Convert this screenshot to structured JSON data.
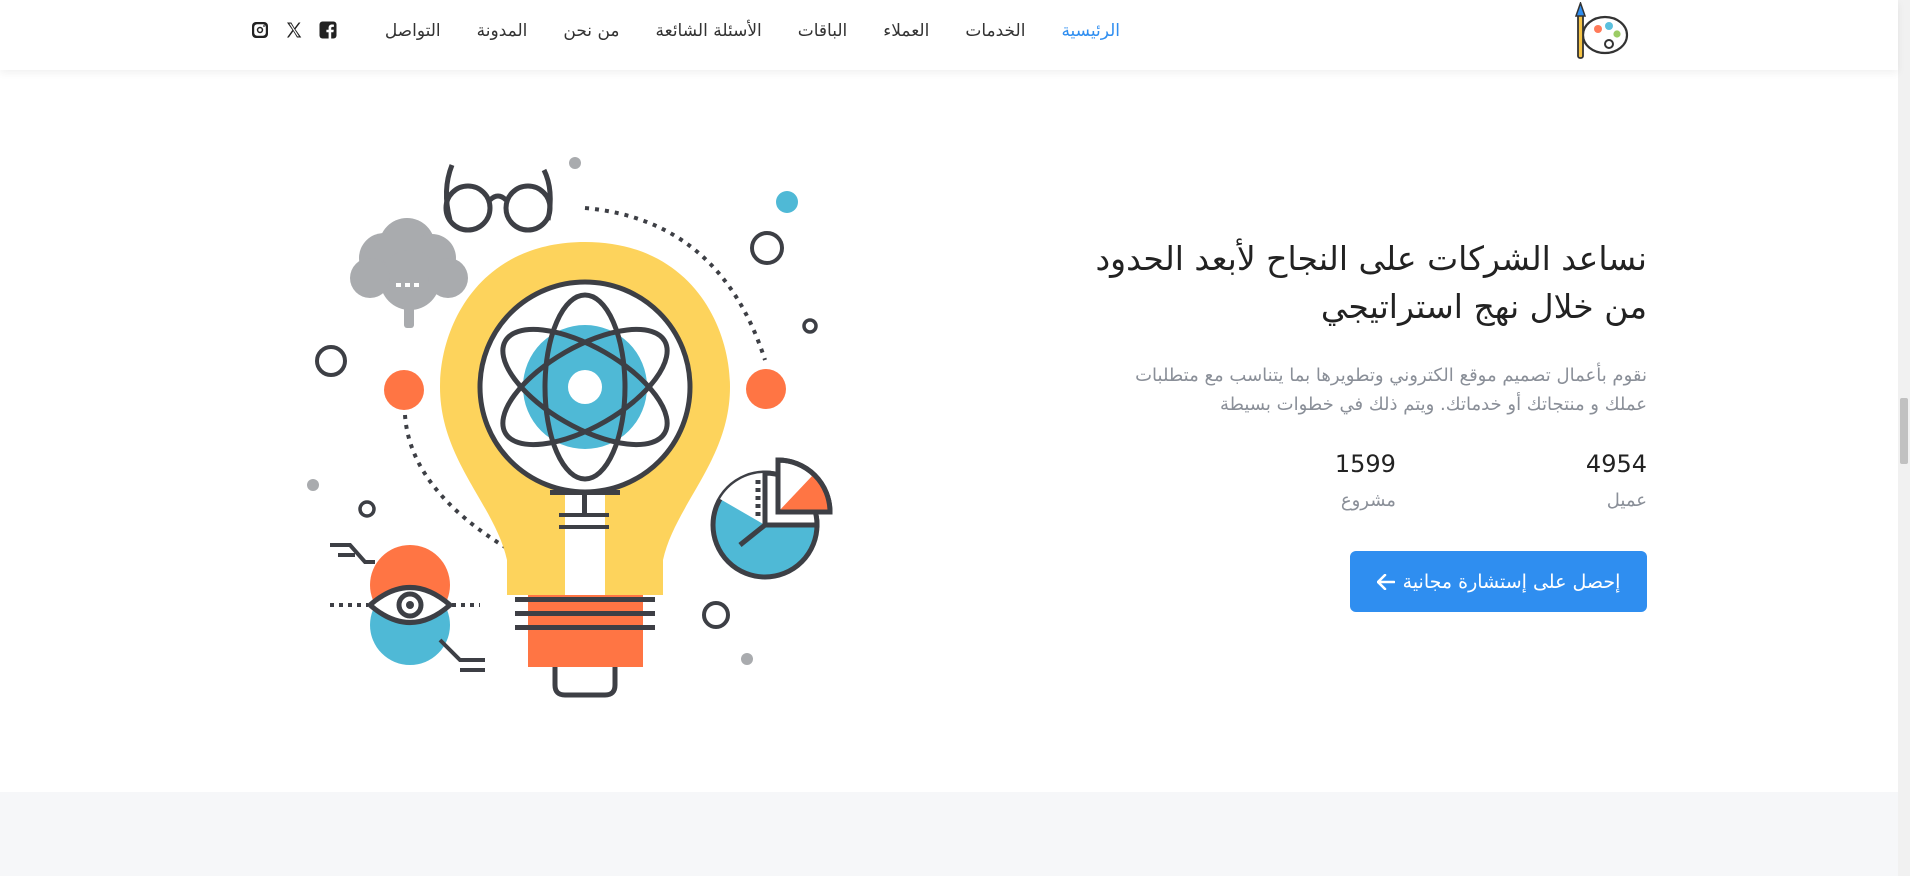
{
  "header": {
    "nav": [
      {
        "label": "الرئيسية",
        "active": true
      },
      {
        "label": "الخدمات",
        "active": false
      },
      {
        "label": "العملاء",
        "active": false
      },
      {
        "label": "الباقات",
        "active": false
      },
      {
        "label": "الأسئلة الشائعة",
        "active": false
      },
      {
        "label": "من نحن",
        "active": false
      },
      {
        "label": "المدونة",
        "active": false
      },
      {
        "label": "التواصل",
        "active": false
      }
    ],
    "social_icons": [
      "facebook-icon",
      "x-twitter-icon",
      "instagram-icon"
    ]
  },
  "hero": {
    "title_line1": "نساعد الشركات على النجاح لأبعد الحدود",
    "title_line2": "من خلال نهج استراتيجي",
    "description_line1": "نقوم بأعمال تصميم موقع الكتروني وتطويرها بما يتناسب مع متطلبات",
    "description_line2": "عملك و منتجاتك أو خدماتك. ويتم ذلك في خطوات بسيطة",
    "stats": [
      {
        "value": "4954",
        "label": "عميل"
      },
      {
        "value": "1599",
        "label": "مشروع"
      }
    ],
    "cta_label": "إحصل على إستشارة مجانية",
    "cta_icon": "arrow-left-icon"
  },
  "colors": {
    "accent": "#2f8ef0",
    "bulb_yellow": "#fdd35c",
    "orange": "#ff7544",
    "teal": "#4fb9d6",
    "outline": "#3d3f45"
  }
}
